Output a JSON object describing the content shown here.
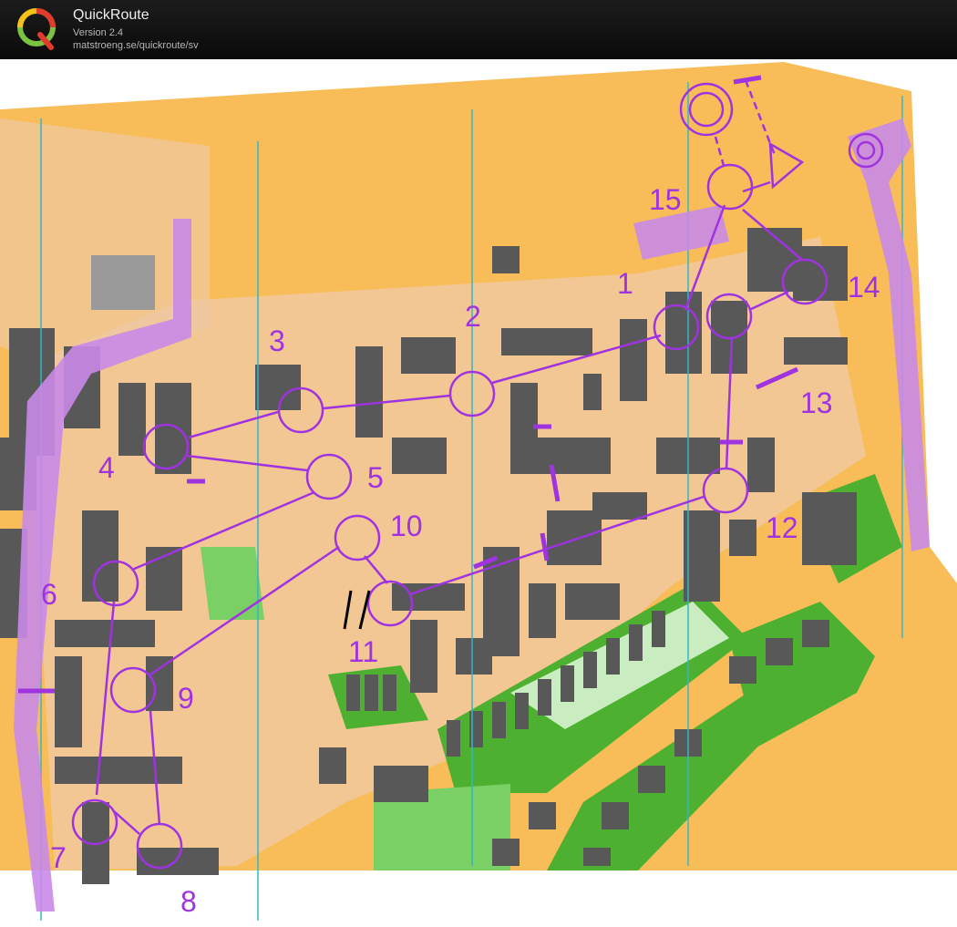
{
  "app": {
    "title": "QuickRoute",
    "version": "Version 2.4",
    "url": "matstroeng.se/quickroute/sv",
    "logo_letter": "Q"
  },
  "map": {
    "colors": {
      "open_land": "#f8bd58",
      "paved": "#f0c9a4",
      "building": "#585858",
      "forest_green": "#4db030",
      "light_green": "#c9ecc0",
      "overprint": "#a033e0",
      "north_lines": "#33b6c9",
      "background": "#ffffff"
    },
    "course": {
      "start_symbol": "triangle",
      "finish_symbol": "double-circle",
      "controls": [
        {
          "number": "1"
        },
        {
          "number": "2"
        },
        {
          "number": "3"
        },
        {
          "number": "4"
        },
        {
          "number": "5"
        },
        {
          "number": "6"
        },
        {
          "number": "7"
        },
        {
          "number": "8"
        },
        {
          "number": "9"
        },
        {
          "number": "10"
        },
        {
          "number": "11"
        },
        {
          "number": "12"
        },
        {
          "number": "13"
        },
        {
          "number": "14"
        },
        {
          "number": "15"
        }
      ]
    }
  }
}
